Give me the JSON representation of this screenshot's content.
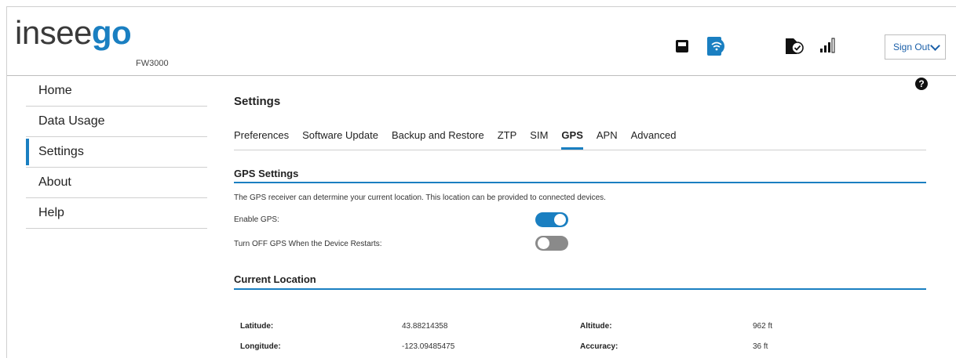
{
  "header": {
    "logo_text": "insee",
    "logo_accent": "go",
    "model": "FW3000",
    "sign_out_label": "Sign Out",
    "icons": [
      "ethernet-icon",
      "wifi-icon",
      "sim-icon",
      "signal-icon"
    ]
  },
  "sidebar": {
    "items": [
      {
        "label": "Home"
      },
      {
        "label": "Data Usage"
      },
      {
        "label": "Settings"
      },
      {
        "label": "About"
      },
      {
        "label": "Help"
      }
    ],
    "active": "Settings"
  },
  "main": {
    "title": "Settings",
    "help_glyph": "?",
    "tabs": [
      {
        "label": "Preferences"
      },
      {
        "label": "Software Update"
      },
      {
        "label": "Backup and Restore"
      },
      {
        "label": "ZTP"
      },
      {
        "label": "SIM"
      },
      {
        "label": "GPS"
      },
      {
        "label": "APN"
      },
      {
        "label": "Advanced"
      }
    ],
    "active_tab": "GPS",
    "gps_settings": {
      "title": "GPS Settings",
      "description": "The GPS receiver can determine your current location. This location can be provided to connected devices.",
      "enable_gps_label": "Enable GPS:",
      "enable_gps_value": true,
      "turn_off_label": "Turn OFF GPS When the Device Restarts:",
      "turn_off_value": false
    },
    "current_location": {
      "title": "Current Location",
      "latitude_label": "Latitude:",
      "latitude_value": "43.88214358",
      "longitude_label": "Longitude:",
      "longitude_value": "-123.09485475",
      "altitude_label": "Altitude:",
      "altitude_value": "962 ft",
      "accuracy_label": "Accuracy:",
      "accuracy_value": "36 ft"
    }
  },
  "colors": {
    "accent": "#1a7fc1",
    "toggle_off": "#8a8a8a",
    "sign_out_text": "#1a5fa8"
  }
}
